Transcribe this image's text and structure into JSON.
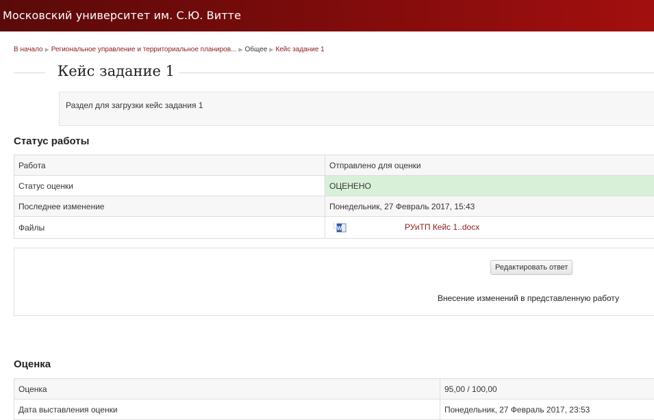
{
  "header": {
    "site_title": "Московский университет им. С.Ю. Витте"
  },
  "breadcrumb": {
    "items": [
      "В начало",
      "Региональное управление и территориальное планиров...",
      "Общее",
      "Кейс задание 1"
    ]
  },
  "page": {
    "title": "Кейс задание 1",
    "intro": "Раздел для загрузки кейс задания 1"
  },
  "submission_status": {
    "heading": "Статус работы",
    "rows": [
      {
        "label": "Работа",
        "value": "Отправлено для оценки"
      },
      {
        "label": "Статус оценки",
        "value": "ОЦЕНЕНО"
      },
      {
        "label": "Последнее изменение",
        "value": "Понедельник, 27 Февраль 2017, 15:43"
      },
      {
        "label": "Файлы",
        "value": "РУиТП Кейс 1..docx"
      }
    ],
    "graded_color": "#d8f0d8",
    "file_icon": "word-doc-icon"
  },
  "actions": {
    "edit_button": "Редактировать ответ",
    "edit_description": "Внесение изменений в представленную работу"
  },
  "grade": {
    "heading": "Оценка",
    "rows": [
      {
        "label": "Оценка",
        "value": "95,00 / 100,00"
      },
      {
        "label": "Дата выставления оценки",
        "value": "Понедельник, 27 Февраль 2017, 23:53"
      }
    ]
  },
  "colors": {
    "header_start": "#5a0a0a",
    "header_end": "#a30f0f",
    "link": "#8b1a1a"
  }
}
